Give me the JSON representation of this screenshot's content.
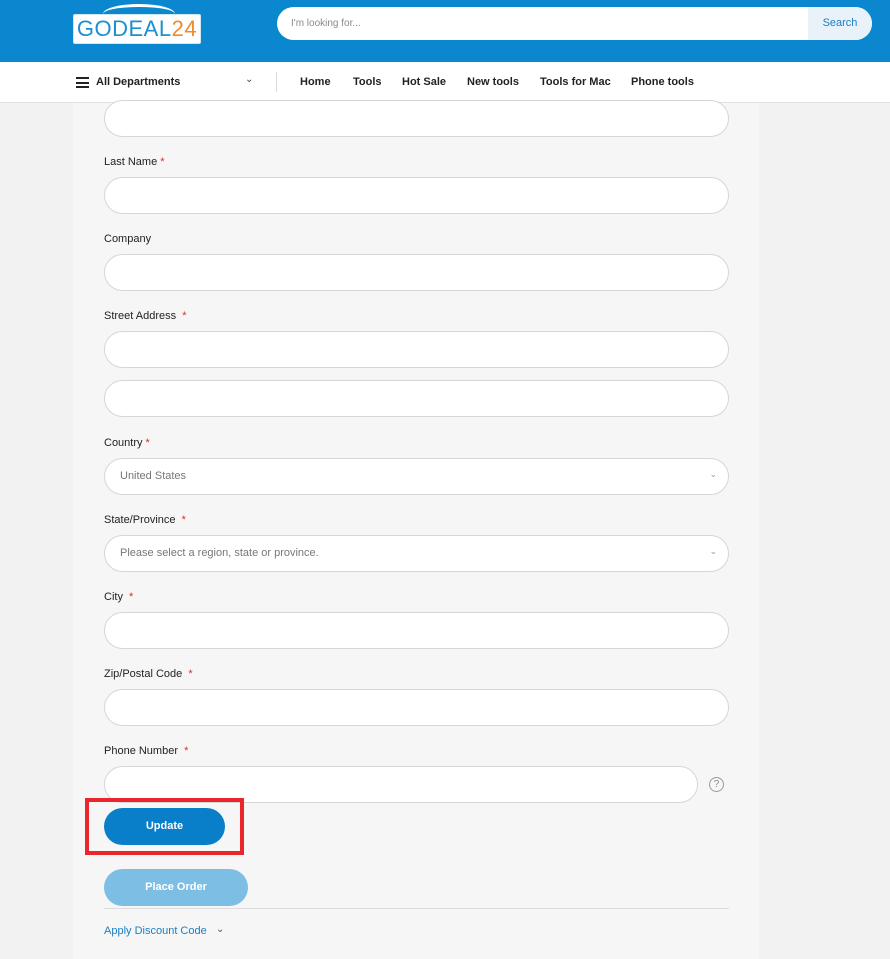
{
  "header": {
    "logo": {
      "part1": "GO",
      "part2": "DEAL",
      "part3": "24"
    },
    "search": {
      "placeholder": "I'm looking for...",
      "button_label": "Search"
    }
  },
  "nav": {
    "departments_label": "All Departments",
    "items": [
      "Home",
      "Tools",
      "Hot Sale",
      "New tools",
      "Tools for Mac",
      "Phone tools"
    ]
  },
  "form": {
    "last_name_label": "Last Name",
    "company_label": "Company",
    "street_label": "Street Address",
    "country_label": "Country",
    "country_value": "United States",
    "state_label": "State/Province",
    "state_placeholder": "Please select a region, state or province.",
    "city_label": "City",
    "zip_label": "Zip/Postal Code",
    "phone_label": "Phone Number",
    "required_marker": "*",
    "help_icon": "?"
  },
  "actions": {
    "update_label": "Update",
    "place_order_label": "Place Order",
    "discount_label": "Apply Discount Code"
  },
  "colors": {
    "brand_blue": "#0a87cf",
    "button_blue": "#0a7fc9",
    "button_disabled": "#7dbfe4",
    "required_red": "#e02b27",
    "highlight_red": "#e8262c"
  },
  "icons": {
    "menu": "hamburger-icon",
    "dept_chevron": "chevron-down-icon",
    "select_chevron": "chevron-down-icon",
    "help": "question-circle-icon",
    "discount_chevron": "chevron-down-icon"
  }
}
